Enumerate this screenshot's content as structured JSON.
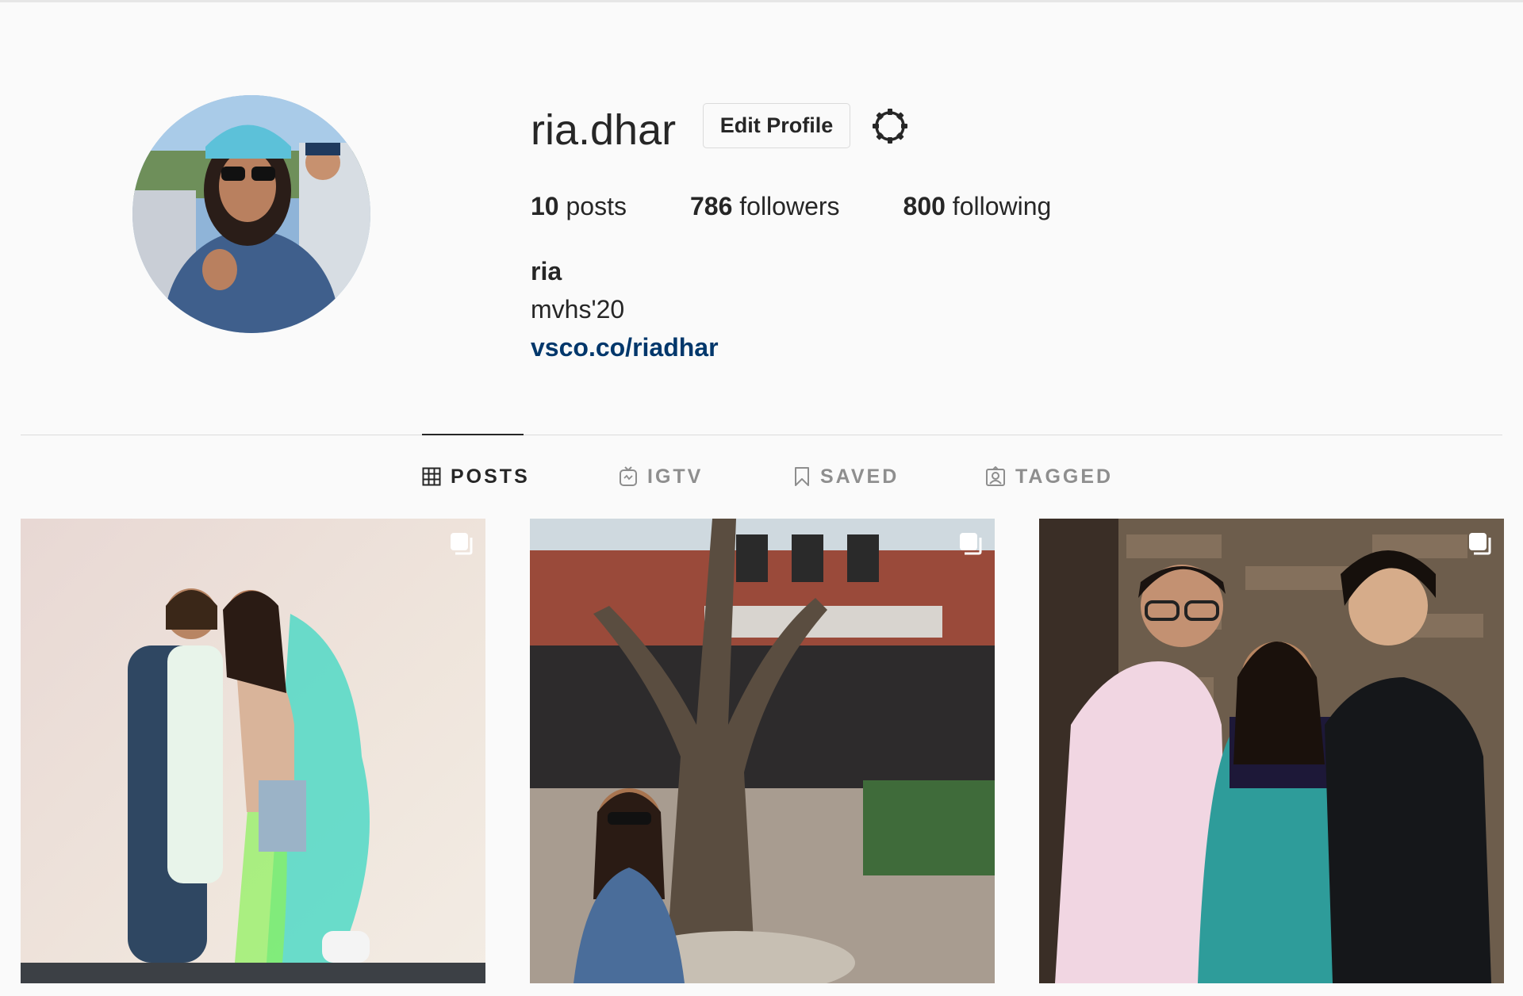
{
  "profile": {
    "username": "ria.dhar",
    "edit_profile_label": "Edit Profile",
    "stats": {
      "posts_count": "10",
      "posts_label": "posts",
      "followers_count": "786",
      "followers_label": "followers",
      "following_count": "800",
      "following_label": "following"
    },
    "full_name": "ria",
    "bio": "mvhs'20",
    "website": "vsco.co/riadhar"
  },
  "tabs": [
    {
      "label": "POSTS",
      "icon": "grid-icon",
      "active": true
    },
    {
      "label": "IGTV",
      "icon": "igtv-icon",
      "active": false
    },
    {
      "label": "SAVED",
      "icon": "bookmark-icon",
      "active": false
    },
    {
      "label": "TAGGED",
      "icon": "tagged-icon",
      "active": false
    }
  ],
  "posts": [
    {
      "multiple": true,
      "icon": "carousel-icon"
    },
    {
      "multiple": true,
      "icon": "carousel-icon"
    },
    {
      "multiple": true,
      "icon": "carousel-icon"
    }
  ],
  "colors": {
    "background": "#fafafa",
    "text": "#262626",
    "muted": "#8e8e8e",
    "link": "#00376b",
    "border": "#dbdbdb"
  }
}
